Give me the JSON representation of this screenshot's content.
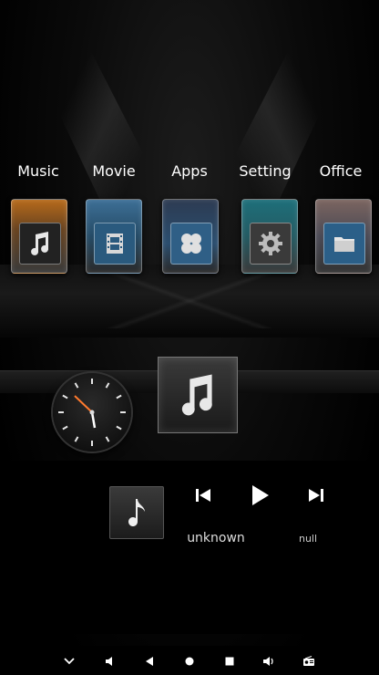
{
  "categories": [
    {
      "label": "Music",
      "icon": "music-note-icon"
    },
    {
      "label": "Movie",
      "icon": "film-icon"
    },
    {
      "label": "Apps",
      "icon": "apps-grid-icon"
    },
    {
      "label": "Setting",
      "icon": "gear-icon"
    },
    {
      "label": "Office",
      "icon": "folder-icon"
    }
  ],
  "clock": {
    "hour_hand_color": "#ffffff",
    "minute_hand_color": "#ff7a2e"
  },
  "player": {
    "title": "unknown",
    "artist": "null",
    "controls": [
      "skip-previous-icon",
      "play-icon",
      "skip-next-icon"
    ]
  },
  "nav_bar": [
    "chevron-down-icon",
    "volume-down-icon",
    "back-icon",
    "home-icon",
    "recents-icon",
    "volume-up-icon",
    "radio-icon"
  ]
}
